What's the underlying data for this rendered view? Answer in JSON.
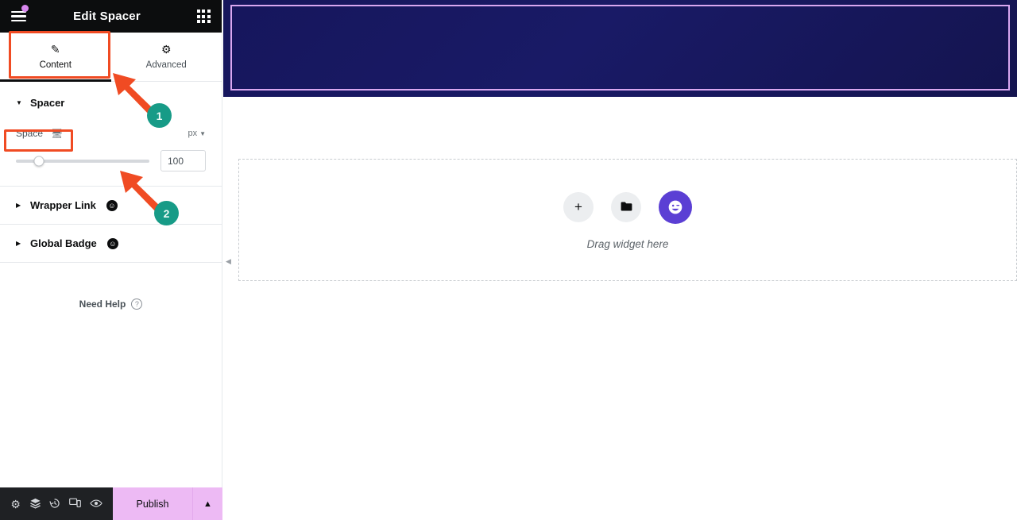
{
  "panel": {
    "title": "Edit Spacer",
    "hamburger_icon": "hamburger-menu-icon",
    "notification_dot": "notification-dot",
    "widgets_grid_icon": "widgets-grid-icon",
    "tabs": [
      {
        "label": "Content",
        "icon": "pencil-icon",
        "active": true
      },
      {
        "label": "Advanced",
        "icon": "gear-icon",
        "active": false
      }
    ],
    "sections": [
      {
        "title": "Spacer",
        "expanded": true,
        "pro": false
      },
      {
        "title": "Wrapper Link",
        "expanded": false,
        "pro": true,
        "pro_icon": "elementor-pro-badge-icon"
      },
      {
        "title": "Global Badge",
        "expanded": false,
        "pro": true,
        "pro_icon": "elementor-pro-badge-icon"
      }
    ],
    "space_control": {
      "label": "Space",
      "device_icon": "desktop-icon",
      "unit": "px",
      "unit_caret": "chevron-down-icon",
      "value": "100",
      "slider_percent": 17
    },
    "need_help": {
      "label": "Need Help",
      "icon": "question-mark-icon"
    },
    "collapse_handle_icon": "chevron-left-icon"
  },
  "footer": {
    "icons": [
      {
        "name": "settings-icon",
        "glyph": "⚙"
      },
      {
        "name": "navigator-layers-icon",
        "glyph": "≣"
      },
      {
        "name": "history-icon",
        "glyph": "↺"
      },
      {
        "name": "responsive-mode-icon",
        "glyph": "▭"
      },
      {
        "name": "preview-eye-icon",
        "glyph": "◉"
      }
    ],
    "publish_label": "Publish",
    "publish_caret": "chevron-up-icon",
    "publish_bg": "#edbaf4"
  },
  "canvas": {
    "hero": {
      "bg_color": "#16165c",
      "selection_outline_color": "#d9a7f0"
    },
    "dropzone": {
      "text": "Drag widget here",
      "buttons": [
        {
          "name": "add-widget-button",
          "glyph": "+"
        },
        {
          "name": "folder-templates-button",
          "glyph": "▰"
        },
        {
          "name": "elementor-ai-button",
          "glyph": "☺"
        }
      ]
    }
  },
  "annotations": {
    "highlight_color": "#f04b23",
    "marker_color": "#179b87",
    "markers": [
      {
        "label": "1",
        "target": "content-tab"
      },
      {
        "label": "2",
        "target": "space-control"
      }
    ]
  }
}
